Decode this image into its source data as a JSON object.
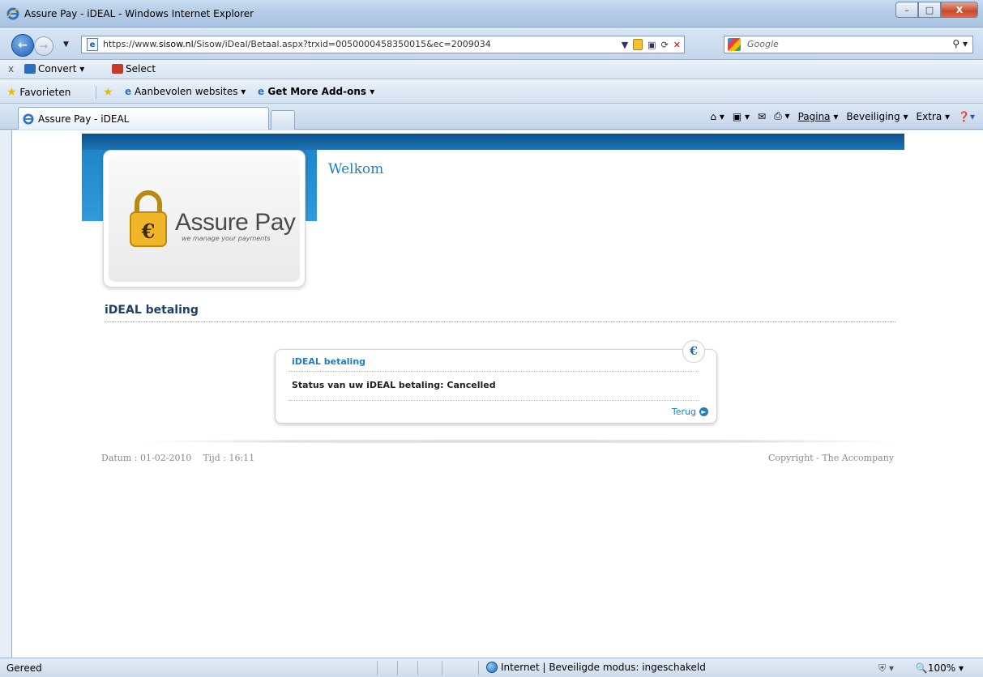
{
  "window": {
    "title": "Assure Pay - iDEAL - Windows Internet Explorer",
    "buttons": {
      "minimize": "–",
      "maximize": "□",
      "close": "X"
    }
  },
  "address": {
    "url_prefix": "https://www.",
    "url_domain": "sisow.nl",
    "url_path": "/Sisow/iDeal/Betaal.aspx?trxid=0050000458350015&ec=2009034"
  },
  "search": {
    "placeholder": "Google"
  },
  "toolbar": {
    "close": "x",
    "convert": "Convert",
    "select": "Select"
  },
  "favorites": {
    "favorites_label": "Favorieten",
    "recommended_label": "Aanbevolen websites",
    "addons_label": "Get More Add-ons"
  },
  "tab": {
    "label": "Assure Pay - iDEAL"
  },
  "commands": {
    "page": "Pagina",
    "security": "Beveiliging",
    "extra": "Extra"
  },
  "page": {
    "brand": "Assure Pay",
    "tagline": "we manage your payments",
    "welcome": "Welkom",
    "section_title": "iDEAL betaling",
    "box_title": "iDEAL betaling",
    "status_text": "Status van uw iDEAL betaling: Cancelled",
    "back_link": "Terug",
    "footer_date": "Datum : 01-02-2010",
    "footer_time": "Tijd : 16:11",
    "footer_copyright": "Copyright - The Accompany"
  },
  "statusbar": {
    "state": "Gereed",
    "zone": "Internet | Beveiligde modus: ingeschakeld",
    "zoom": "100%"
  }
}
